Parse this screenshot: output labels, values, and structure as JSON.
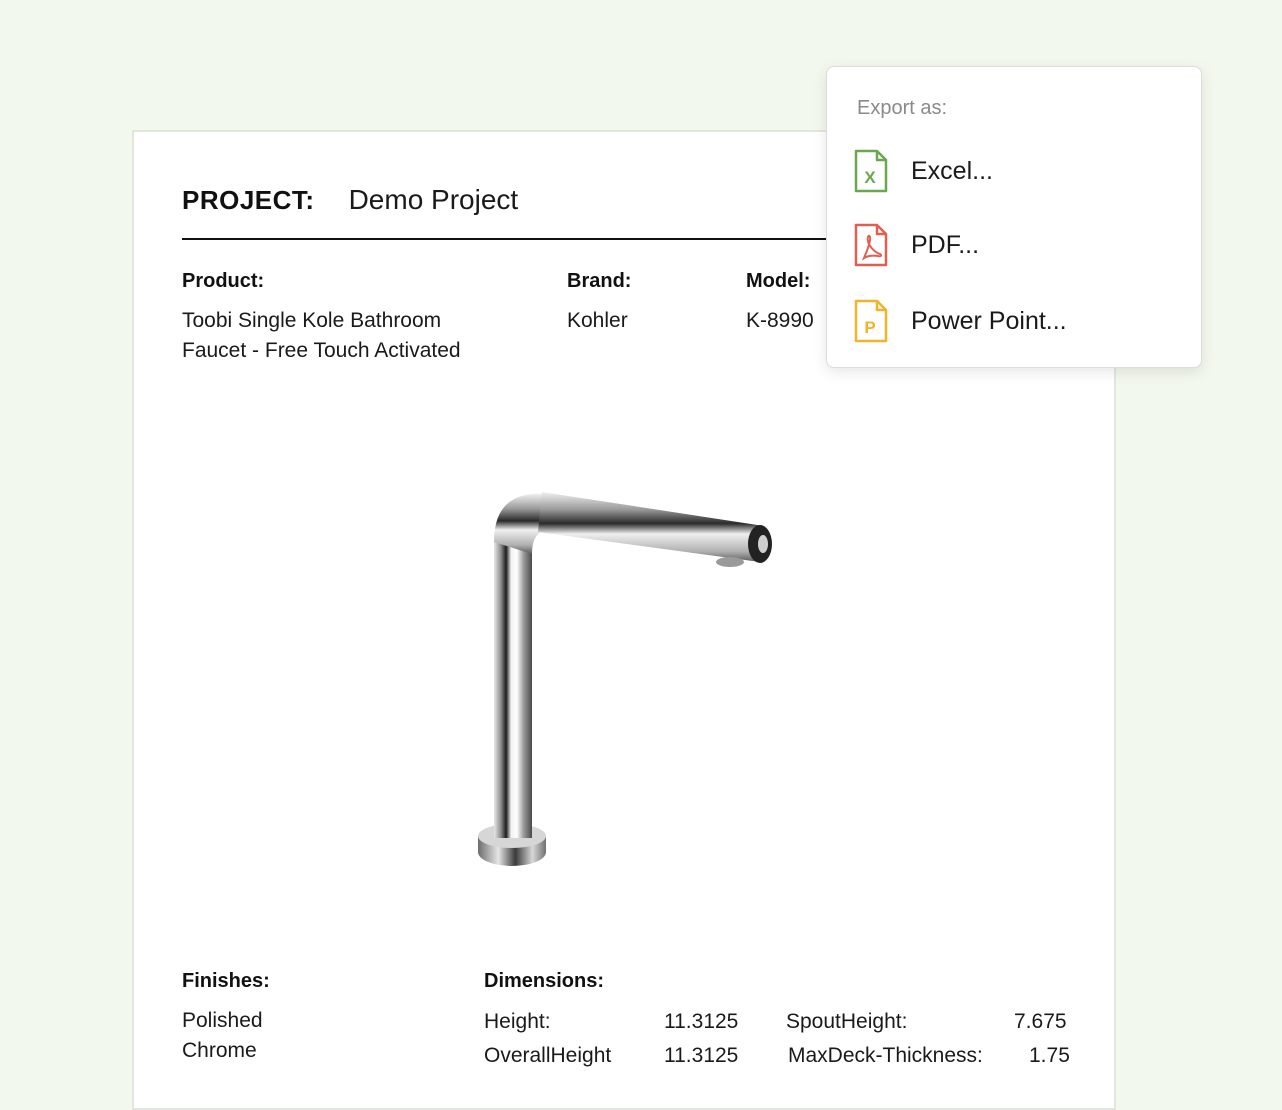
{
  "project": {
    "label": "PROJECT:",
    "name": "Demo Project"
  },
  "fields": {
    "product": {
      "label": "Product:",
      "value": "Toobi Single Kole Bathroom Faucet - Free Touch Activated"
    },
    "brand": {
      "label": "Brand:",
      "value": "Kohler"
    },
    "model": {
      "label": "Model:",
      "value": "K-8990"
    }
  },
  "finishes": {
    "label": "Finishes:",
    "value": "Polished Chrome"
  },
  "dimensions": {
    "label": "Dimensions:",
    "rows": [
      {
        "name": "Height:",
        "value": "11.3125",
        "name2": "SpoutHeight:",
        "value2": "7.675"
      },
      {
        "name": "OverallHeight",
        "value": "11.3125",
        "name2": "MaxDeck-Thickness:",
        "value2": "1.75"
      }
    ]
  },
  "export_menu": {
    "title": "Export as:",
    "items": [
      {
        "label": "Excel...",
        "icon": "excel-file-icon",
        "color": "#6aa84f",
        "letter": "X"
      },
      {
        "label": "PDF...",
        "icon": "pdf-file-icon",
        "color": "#e06050",
        "letter": ""
      },
      {
        "label": "Power Point...",
        "icon": "powerpoint-file-icon",
        "color": "#f0b429",
        "letter": "P"
      }
    ]
  },
  "colors": {
    "background": "#f3f8ee",
    "excel": "#6aa84f",
    "pdf": "#e06050",
    "powerpoint": "#f0b429"
  }
}
